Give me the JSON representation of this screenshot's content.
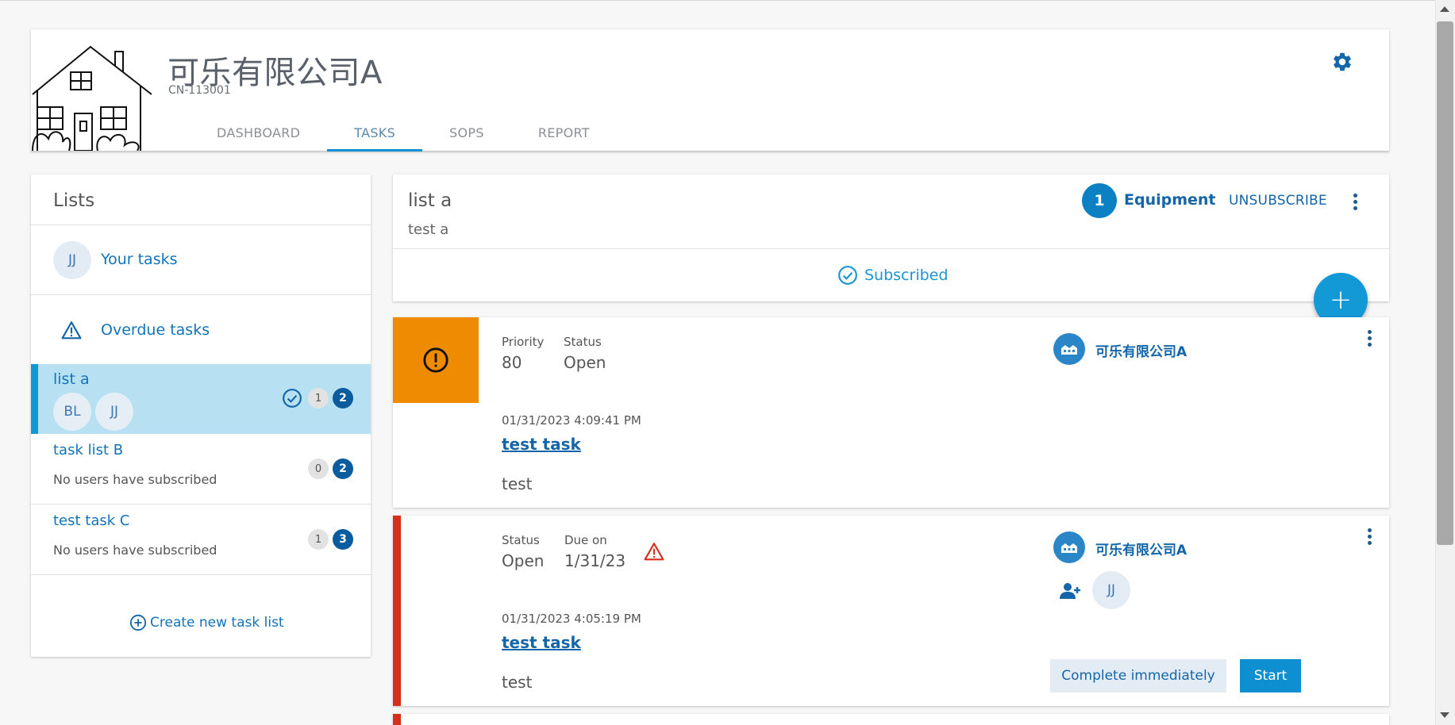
{
  "header": {
    "company_name": "可乐有限公司A",
    "company_code": "CN-113001",
    "tabs": [
      {
        "label": "DASHBOARD",
        "active": false
      },
      {
        "label": "TASKS",
        "active": true
      },
      {
        "label": "SOPS",
        "active": false
      },
      {
        "label": "REPORT",
        "active": false
      }
    ],
    "settings_icon": "gear-icon"
  },
  "lists_panel": {
    "title": "Lists",
    "your_tasks": {
      "avatar": "JJ",
      "label": "Your tasks"
    },
    "overdue_tasks": {
      "icon": "warning-triangle-icon",
      "label": "Overdue tasks"
    },
    "lists": [
      {
        "name": "list a",
        "avatars": [
          "BL",
          "JJ"
        ],
        "subscribed": true,
        "count_grey": "1",
        "count_blue": "2",
        "selected": true
      },
      {
        "name": "task list B",
        "subtitle": "No users have subscribed",
        "count_grey": "0",
        "count_blue": "2",
        "selected": false
      },
      {
        "name": "test task C",
        "subtitle": "No users have subscribed",
        "count_grey": "1",
        "count_blue": "3",
        "selected": false
      }
    ],
    "create_label": "Create new task list"
  },
  "list_header": {
    "name": "list a",
    "description": "test a",
    "equipment_count": "1",
    "equipment_label": "Equipment",
    "unsubscribe_label": "UNSUBSCRIBE",
    "subscribed_label": "Subscribed"
  },
  "fab": {
    "label": "+"
  },
  "tasks": [
    {
      "priority_label": "Priority",
      "priority_value": "80",
      "status_label": "Status",
      "status_value": "Open",
      "timestamp": "01/31/2023 4:09:41 PM",
      "title": "test task",
      "description": "test",
      "site": "可乐有限公司A",
      "accent": "#ef8b00"
    },
    {
      "status_label": "Status",
      "status_value": "Open",
      "due_label": "Due on",
      "due_value": "1/31/23",
      "timestamp": "01/31/2023 4:05:19 PM",
      "title": "test task",
      "description": "test",
      "site": "可乐有限公司A",
      "assignee": "JJ",
      "complete_label": "Complete immediately",
      "start_label": "Start",
      "accent": "#d62f1b"
    }
  ],
  "colors": {
    "primary": "#0e8fd1",
    "link": "#1466a8",
    "selected_bg": "#b7e1f2",
    "warning": "#ef8b00",
    "overdue": "#d62f1b"
  }
}
